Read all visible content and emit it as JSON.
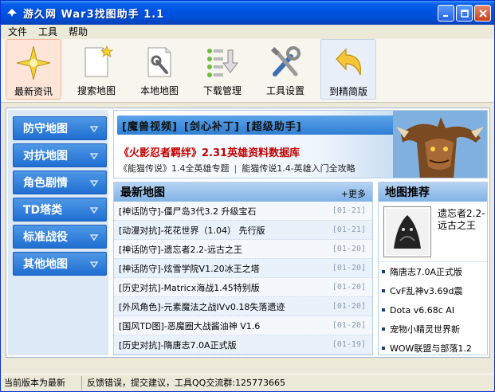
{
  "window": {
    "title": "游久网 War3找图助手 1.1"
  },
  "menu": {
    "items": [
      "文件",
      "工具",
      "帮助"
    ]
  },
  "toolbar": {
    "items": [
      {
        "label": "最新资讯",
        "icon": "star-icon"
      },
      {
        "label": "搜索地图",
        "icon": "new-document-icon"
      },
      {
        "label": "本地地图",
        "icon": "document-wrench-icon"
      },
      {
        "label": "下载管理",
        "icon": "download-list-icon"
      },
      {
        "label": "工具设置",
        "icon": "tools-icon"
      },
      {
        "label": "到精简版",
        "icon": "undo-arrow-icon"
      }
    ]
  },
  "sidebar": {
    "items": [
      "防守地图",
      "对抗地图",
      "角色剧情",
      "TD塔类",
      "标准战役",
      "其他地图"
    ]
  },
  "banner": {
    "nav": [
      "[魔兽视频]",
      "[剑心补丁]",
      "[超级助手]"
    ],
    "headline": "《火影忍者羁绊》2.31英雄资料数据库",
    "sub1": "《能猫传说》1.4全英雄专题",
    "sub2": "能猫传说1.4-英雄入门全攻略"
  },
  "new_maps": {
    "title": "最新地图",
    "more": "+更多",
    "rows": [
      {
        "title": "[神话防守]-僵尸岛3代3.2 升级宝石",
        "date": "[01-21]"
      },
      {
        "title": "[动漫对抗]-花花世界（1.04） 先行版",
        "date": "[01-21]"
      },
      {
        "title": "[神话防守]-遗忘者2.2-远古之王",
        "date": "[01-20]"
      },
      {
        "title": "[神话防守]-炫雪学院V1.20冰王之塔",
        "date": "[01-20]"
      },
      {
        "title": "[历史对抗]-Matricx海战1.45特别版",
        "date": "[01-20]"
      },
      {
        "title": "[外风角色]-元素魔法之战IVv0.18失落遗迹",
        "date": "[01-20]"
      },
      {
        "title": "[国风TD图]-恶魔圈大战酱油神 V1.6",
        "date": "[01-20]"
      },
      {
        "title": "[历史对抗]-隋唐志7.0A正式版",
        "date": "[01-19]"
      }
    ]
  },
  "recommend": {
    "title": "地图推荐",
    "featured": "遗忘者2.2-远古之王",
    "items": [
      "隋唐志7.0A正式版",
      "CvF乱神v3.69d震",
      "Dota v6.68c AI",
      "宠物小精灵世界新",
      "WOW联盟与部落1.2"
    ]
  },
  "status": {
    "left": "当前版本为最新",
    "right": "反馈错误，提交建议，工具QQ交流群:125773665"
  },
  "colors": {
    "titlebar": "#0054e3",
    "sidebar_button": "#2f7fd3",
    "headline": "#c00000"
  }
}
